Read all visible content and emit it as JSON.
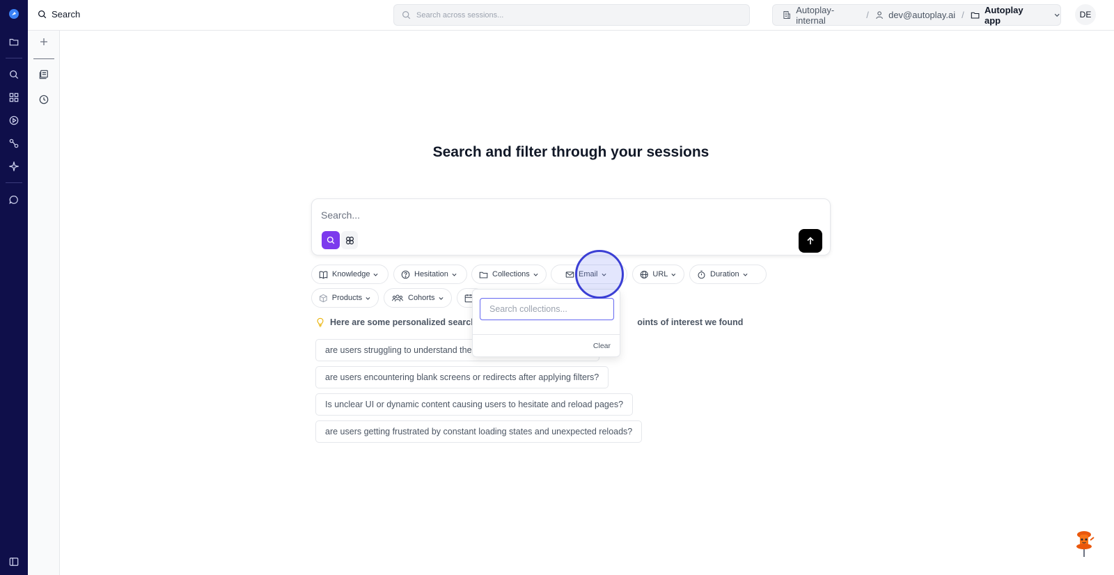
{
  "header": {
    "title": "Search",
    "global_search_placeholder": "Search across sessions...",
    "breadcrumb": {
      "org": "Autoplay-internal",
      "user": "dev@autoplay.ai",
      "app": "Autoplay app"
    },
    "avatar_initials": "DE"
  },
  "main": {
    "heading": "Search and filter through your sessions",
    "search_placeholder": "Search...",
    "filters": {
      "knowledge": "Knowledge",
      "hesitation": "Hesitation",
      "collections": "Collections",
      "email": "Email",
      "url": "URL",
      "duration": "Duration",
      "products": "Products",
      "cohorts": "Cohorts"
    },
    "tip_text": "Here are some personalized search s",
    "tip_text_end": "oints of interest we found",
    "suggestions": [
      "are users struggling to understand the",
      "are users encountering blank screens or redirects after applying filters?",
      "Is unclear UI or dynamic content causing users to hesitate and reload pages?",
      "are users getting frustrated by constant loading states and unexpected reloads?"
    ]
  },
  "dropdown": {
    "search_placeholder": "Search collections...",
    "clear_label": "Clear"
  },
  "colors": {
    "rail_bg": "#0f0f4a",
    "accent_purple": "#7c3aed",
    "focus_ring": "#6366f1"
  }
}
